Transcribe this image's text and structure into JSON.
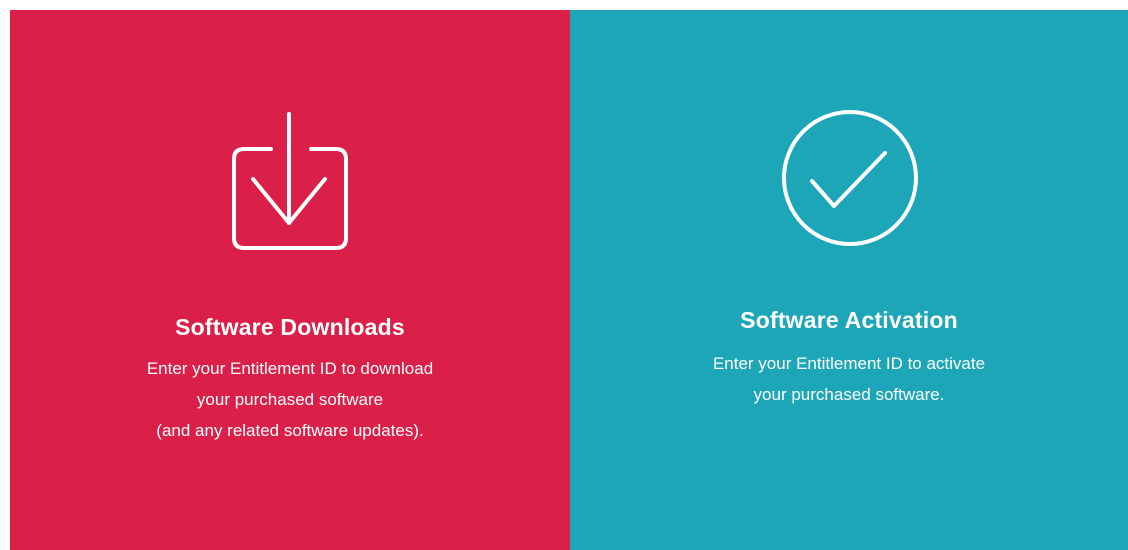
{
  "cards": {
    "downloads": {
      "icon": "download-icon",
      "title": "Software Downloads",
      "description_lines": [
        "Enter your Entitlement ID to download",
        "your purchased software",
        "(and any related software updates)."
      ],
      "background": "#da1f48"
    },
    "activation": {
      "icon": "checkmark-circle-icon",
      "title": "Software Activation",
      "description_lines": [
        "Enter your Entitlement ID to activate",
        "your purchased software."
      ],
      "background": "#1ca6b7"
    }
  }
}
